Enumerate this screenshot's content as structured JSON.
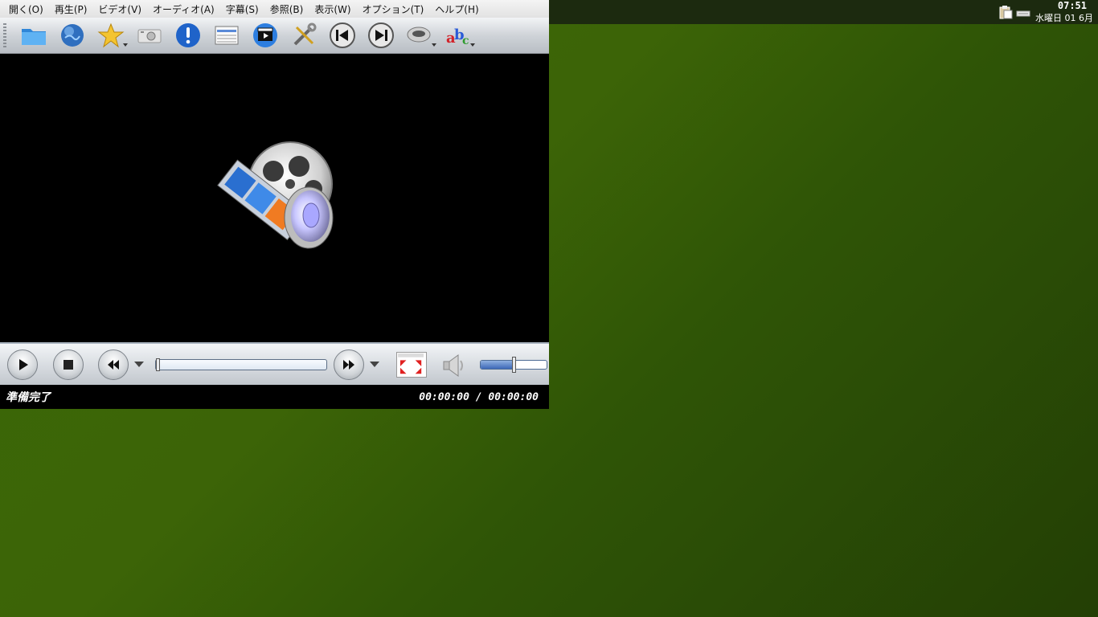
{
  "menubar": {
    "items": [
      "開く(O)",
      "再生(P)",
      "ビデオ(V)",
      "オーディオ(A)",
      "字幕(S)",
      "参照(B)",
      "表示(W)",
      "オプション(T)",
      "ヘルプ(H)"
    ]
  },
  "toolbar": {
    "buttons": [
      "open-folder",
      "open-url",
      "favorites",
      "screenshot",
      "info",
      "playlist",
      "video-filters",
      "preferences",
      "previous",
      "next",
      "audio-track",
      "subtitles"
    ]
  },
  "status": {
    "text": "準備完了",
    "time": "00:00:00 / 00:00:00"
  },
  "controls": {
    "seek_position": 0,
    "volume": 0.5
  },
  "panel": {
    "time": "07:51",
    "date": "水曜日 01 6月"
  },
  "colors": {
    "desktop": "#3c6407",
    "panel": "#1c2a0f",
    "video_bg": "#000000"
  }
}
